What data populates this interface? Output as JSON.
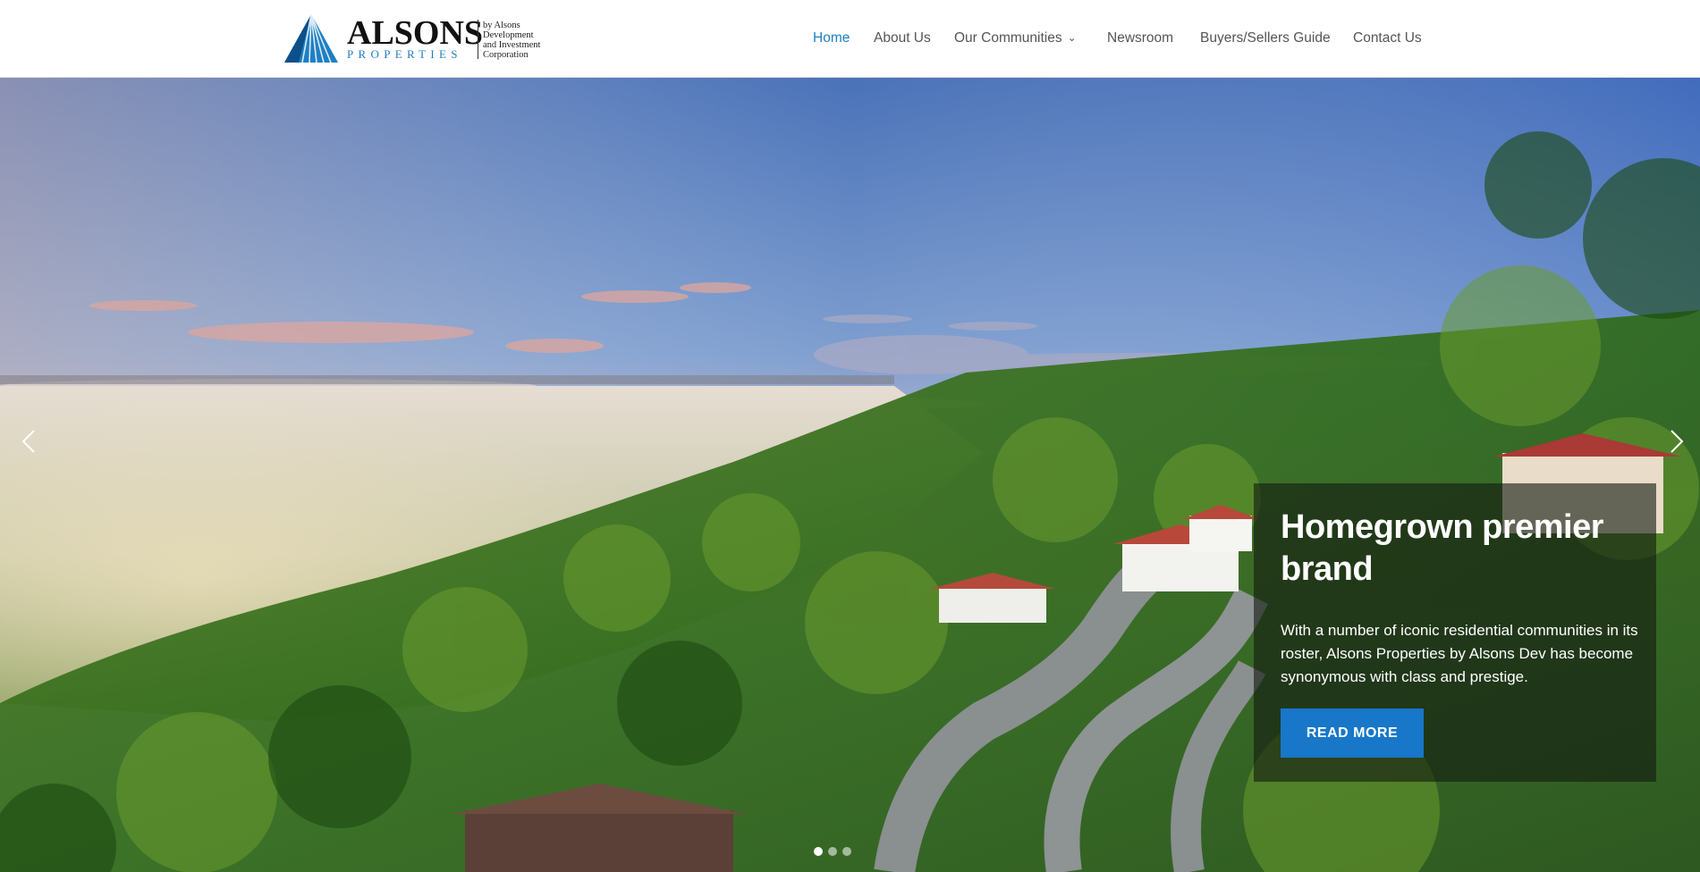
{
  "brand": {
    "name": "ALSONS",
    "sub": "PROPERTIES",
    "tagline": [
      "by Alsons",
      "Development",
      "and Investment",
      "Corporation"
    ],
    "blue": "#1f7fc4"
  },
  "nav": {
    "items": [
      {
        "label": "Home",
        "active": true
      },
      {
        "label": "About Us"
      },
      {
        "label": "Our Communities",
        "dropdown_icon": "chevron-down-icon"
      },
      {
        "label": "Newsroom"
      },
      {
        "label": "Buyers/Sellers Guide"
      },
      {
        "label": "Contact Us"
      }
    ]
  },
  "hero": {
    "heading": "Homegrown premier brand",
    "body": "With a number of iconic residential communities in its roster, Alsons Properties by Alsons Dev has become synonymous with class and prestige.",
    "button_label": "READ MORE",
    "prev_icon": "chevron-left-icon",
    "next_icon": "chevron-right-icon",
    "slide_count": 3,
    "active_slide": 1,
    "button_color": "#1877c9"
  }
}
